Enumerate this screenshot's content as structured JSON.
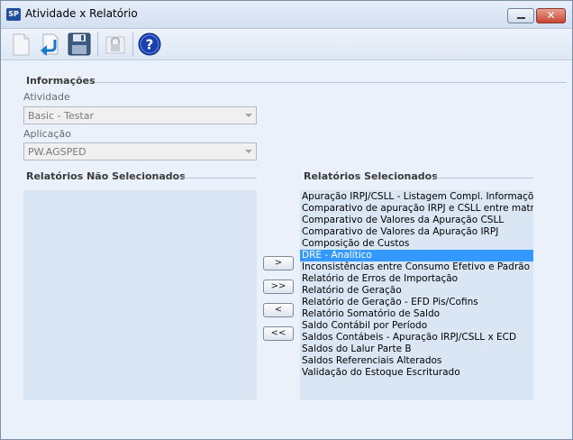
{
  "window": {
    "title": "Atividade x Relatório",
    "app_icon_text": "SP"
  },
  "toolbar": {
    "buttons": [
      {
        "icon": "new-document-icon",
        "enabled": false
      },
      {
        "icon": "undo-arrow-icon",
        "enabled": true
      },
      {
        "icon": "save-disk-icon",
        "enabled": true
      },
      {
        "icon": "lock-icon",
        "enabled": false
      },
      {
        "icon": "help-icon",
        "enabled": true,
        "text": "?"
      }
    ]
  },
  "info": {
    "section_title": "Informações",
    "atividade_label": "Atividade",
    "atividade_value": "Basic - Testar",
    "aplicacao_label": "Aplicação",
    "aplicacao_value": "PW.AGSPED"
  },
  "left_list": {
    "title": "Relatórios Não Selecionados",
    "items": []
  },
  "right_list": {
    "title": "Relatórios Selecionados",
    "selected_index": 5,
    "items": [
      "Apuração IRPJ/CSLL - Listagem Compl. Informações",
      "Comparativo de apuração IRPJ e CSLL entre matrizes",
      "Comparativo de Valores da Apuração CSLL",
      "Comparativo de Valores da Apuração IRPJ",
      "Composição de Custos",
      "DRE - Analítico",
      "Inconsistências entre Consumo Efetivo e Padrão",
      "Relatório de Erros de Importação",
      "Relatório de Geração",
      "Relatório de Geração - EFD Pis/Cofins",
      "Relatório Somatório de Saldo",
      "Saldo Contábil por Período",
      "Saldos Contábeis - Apuração IRPJ/CSLL x ECD",
      "Saldos do Lalur Parte B",
      "Saldos Referenciais Alterados",
      "Validação do Estoque Escriturado"
    ]
  },
  "move_buttons": {
    "add": ">",
    "add_all": ">>",
    "remove": "<",
    "remove_all": "<<"
  },
  "colors": {
    "background": "#eaf1fb",
    "list_background": "#dbe6f5",
    "selection": "#3399ff",
    "help_blue": "#1a3fb0"
  }
}
